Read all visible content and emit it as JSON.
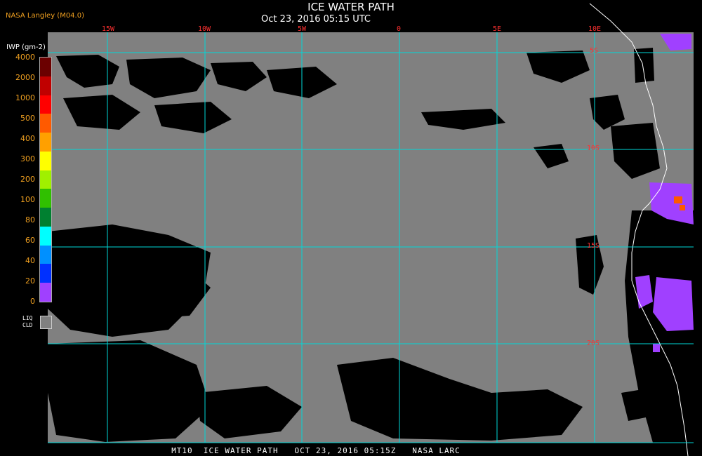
{
  "header": {
    "title": "ICE WATER PATH",
    "subtitle": "Oct 23, 2016 05:15 UTC",
    "agency": "NASA Langley (M04.0)"
  },
  "legend": {
    "title": "IWP (gm-2)",
    "ticks": [
      "4000",
      "2000",
      "1000",
      "500",
      "400",
      "300",
      "200",
      "100",
      "80",
      "60",
      "40",
      "20",
      "0"
    ],
    "colors": [
      "#6b0000",
      "#c00000",
      "#ff0000",
      "#ff5a00",
      "#ffa000",
      "#ffff00",
      "#a0f000",
      "#30c000",
      "#008030",
      "#00ffff",
      "#0090ff",
      "#0030ff",
      "#a040ff"
    ],
    "liq_label_1": "LIQ",
    "liq_label_2": "CLD",
    "liq_color": "#808080"
  },
  "map": {
    "background": "#808080",
    "grid_color": "#00d8d8",
    "longitude_labels": [
      "15W",
      "10W",
      "5W",
      "0",
      "5E",
      "10E"
    ],
    "latitude_labels": [
      "5S",
      "10S",
      "15S",
      "20S"
    ]
  },
  "footer": {
    "text": "MT10  ICE WATER PATH   OCT 23, 2016 05:15Z   NASA LARC"
  }
}
